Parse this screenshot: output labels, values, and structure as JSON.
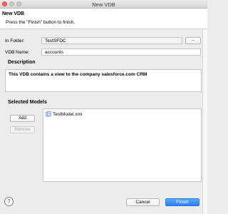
{
  "window": {
    "title": "New VDB"
  },
  "header": {
    "title": "New VDB",
    "message": "Press the \"Finish\" button to finish."
  },
  "folder": {
    "label": "In Folder:",
    "value": "TestSFDC",
    "browse_label": "..."
  },
  "vdb_name": {
    "label": "VDB Name:",
    "value": "accounts"
  },
  "description": {
    "title": "Description",
    "value": "This VDB contains a view to the company salesforce.com CRM"
  },
  "models": {
    "title": "Selected Models",
    "add_label": "Add",
    "remove_label": "Remove",
    "items": [
      "TestModel.xmi"
    ]
  },
  "footer": {
    "help_label": "?",
    "cancel_label": "Cancel",
    "finish_label": "Finish"
  },
  "colors": {
    "finish_button": "#2c7ff0",
    "close_light": "#fc605c"
  }
}
